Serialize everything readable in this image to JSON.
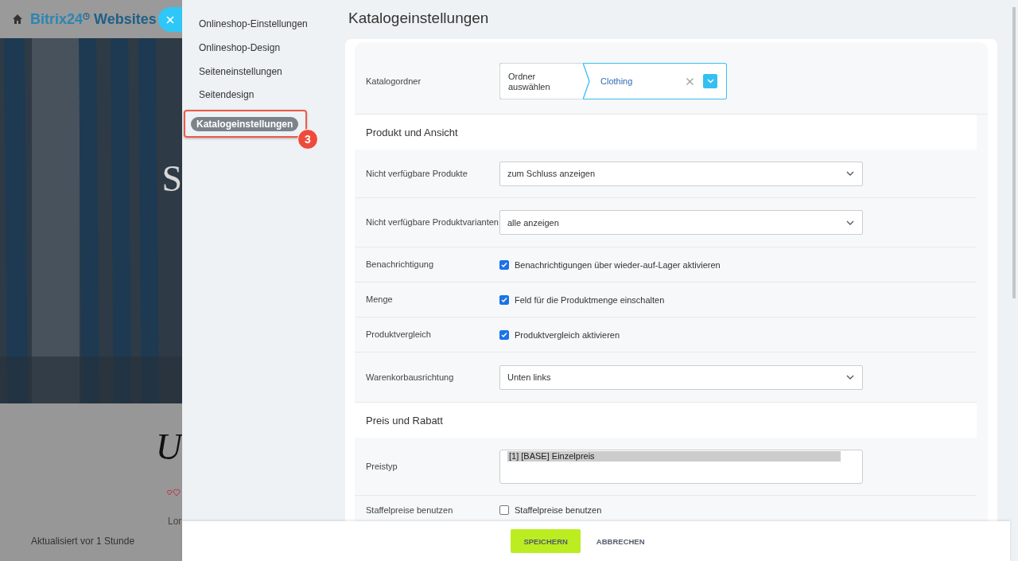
{
  "background_page": {
    "brand": "Bitrix24",
    "brand_suffix": "Websites",
    "heading_letters": [
      "S",
      "U"
    ],
    "text_fragment": "Lor",
    "updated": "Aktualisiert vor 1 Stunde"
  },
  "nav": [
    {
      "label": "Onlineshop-Einstellungen",
      "selected": false
    },
    {
      "label": "Onlineshop-Design",
      "selected": false
    },
    {
      "label": "Seiteneinstellungen",
      "selected": false
    },
    {
      "label": "Seitendesign",
      "selected": false
    },
    {
      "label": "Katalogeinstellungen",
      "selected": true
    }
  ],
  "step_badge": "3",
  "title": "Katalogeinstellungen",
  "rows": [
    {
      "kind": "folder",
      "label": "Katalogordner",
      "button": "Ordner auswählen",
      "value": "Clothing"
    },
    {
      "kind": "header",
      "label": "Produkt und Ansicht"
    },
    {
      "kind": "select",
      "label": "Nicht verfügbare Produkte",
      "value": "zum Schluss anzeigen"
    },
    {
      "kind": "select",
      "label": "Nicht verfügbare Produktvarianten",
      "value": "alle anzeigen"
    },
    {
      "kind": "checkbox",
      "label": "Benachrichtigung",
      "text": "Benachrichtigungen über wieder-auf-Lager aktivieren",
      "checked": true
    },
    {
      "kind": "checkbox",
      "label": "Menge",
      "text": "Feld für die Produktmenge einschalten",
      "checked": true
    },
    {
      "kind": "checkbox",
      "label": "Produktvergleich",
      "text": "Produktvergleich aktivieren",
      "checked": true
    },
    {
      "kind": "select",
      "label": "Warenkorbausrichtung",
      "value": "Unten links"
    },
    {
      "kind": "header",
      "label": "Preis und Rabatt"
    },
    {
      "kind": "listbox",
      "label": "Preistyp",
      "options": [
        {
          "label": "[1] [BASE] Einzelpreis",
          "selected": true
        }
      ]
    },
    {
      "kind": "checkbox",
      "label": "Staffelpreise benutzen",
      "text": "Staffelpreise benutzen",
      "checked": false
    }
  ],
  "footer": {
    "save": "SPEICHERN",
    "cancel": "ABBRECHEN"
  }
}
